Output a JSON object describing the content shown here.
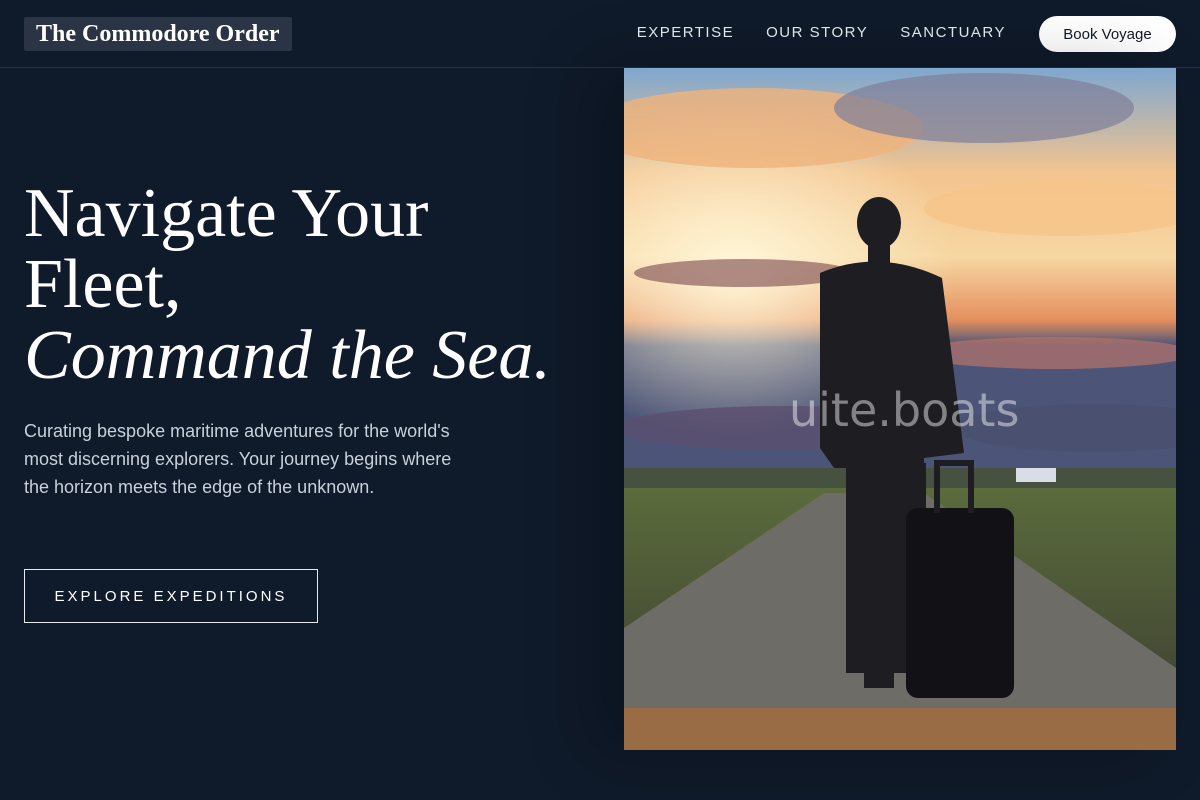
{
  "nav": {
    "logo": "The Commodore Order",
    "links": [
      "EXPERTISE",
      "OUR STORY",
      "SANCTUARY"
    ],
    "cta": "Book Voyage"
  },
  "hero": {
    "headline_line1": "Navigate Your Fleet,",
    "headline_line2": "Command the Sea.",
    "description": "Curating bespoke maritime adventures for the world's most discerning explorers. Your journey begins where the horizon meets the edge of the unknown.",
    "button": "EXPLORE EXPEDITIONS"
  },
  "image": {
    "watermark": "uite.boats",
    "subject": "traveler-with-suitcase-sunset"
  },
  "colors": {
    "background": "#0f1a2a",
    "accent": "#ffffff",
    "text_muted": "#c8d0db"
  }
}
